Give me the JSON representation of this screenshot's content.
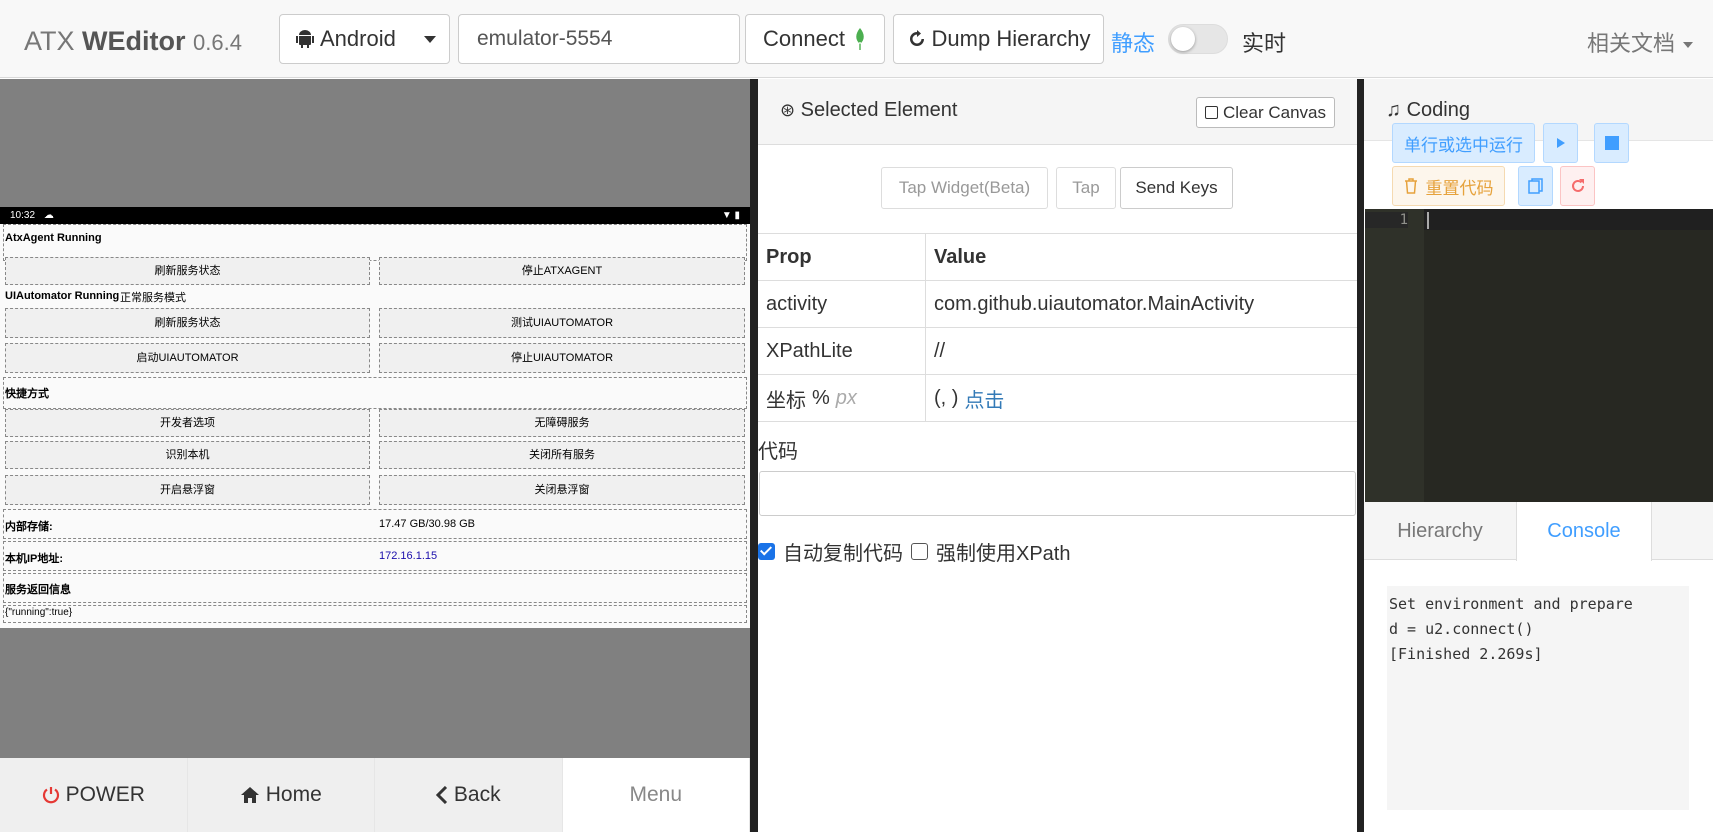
{
  "app": {
    "name_light": "ATX",
    "name_bold": "WEditor",
    "version": "0.6.4"
  },
  "toolbar": {
    "platform": "Android",
    "serial": "emulator-5554",
    "connect_label": "Connect",
    "dump_label": "Dump Hierarchy",
    "static_label": "静态",
    "realtime_label": "实时",
    "docs_label": "相关文档"
  },
  "phone": {
    "status_time": "10:32",
    "atx_title": "AtxAgent Running",
    "btn_refresh": "刷新服务状态",
    "btn_stop_atx": "停止ATXAGENT",
    "uia_title": "UIAutomator Running",
    "uia_mode": "正常服务模式",
    "btn_refresh2": "刷新服务状态",
    "btn_test_uia": "测试UIAUTOMATOR",
    "btn_start_uia": "启动UIAUTOMATOR",
    "btn_stop_uia": "停止UIAUTOMATOR",
    "shortcuts": "快捷方式",
    "btn_dev": "开发者选项",
    "btn_a11y": "无障碍服务",
    "btn_identify": "识别本机",
    "btn_close_all": "关闭所有服务",
    "btn_float_on": "开启悬浮窗",
    "btn_float_off": "关闭悬浮窗",
    "storage_label": "内部存储:",
    "storage_value": "17.47 GB/30.98 GB",
    "ip_label": "本机IP地址:",
    "ip_value": "172.16.1.15",
    "resp_label": "服务返回信息",
    "resp_value": "{\"running\":true}"
  },
  "nav": {
    "power": "POWER",
    "home": "Home",
    "back": "Back",
    "menu": "Menu"
  },
  "selected": {
    "title": "Selected Element",
    "clear_canvas": "Clear Canvas",
    "tap_widget": "Tap Widget(Beta)",
    "tap": "Tap",
    "send_keys": "Send Keys",
    "prop_header": "Prop",
    "value_header": "Value",
    "rows": [
      {
        "prop": "activity",
        "value": "com.github.uiautomator.MainActivity"
      },
      {
        "prop": "XPathLite",
        "value": "//"
      }
    ],
    "coord_label": "坐标",
    "coord_pct": "%",
    "coord_px": "px",
    "coord_value": "(, )",
    "coord_click": "点击",
    "code_label": "代码",
    "auto_copy": "自动复制代码",
    "force_xpath": "强制使用XPath"
  },
  "coding": {
    "title": "Coding",
    "run_line": "单行或选中运行",
    "reset_code": "重置代码",
    "line_no": "1",
    "tab_hierarchy": "Hierarchy",
    "tab_console": "Console",
    "console_text": "Set environment and prepare\nd = u2.connect()\n[Finished 2.269s]"
  },
  "colors": {
    "accent": "#409eff",
    "editor_bg": "#272822"
  }
}
